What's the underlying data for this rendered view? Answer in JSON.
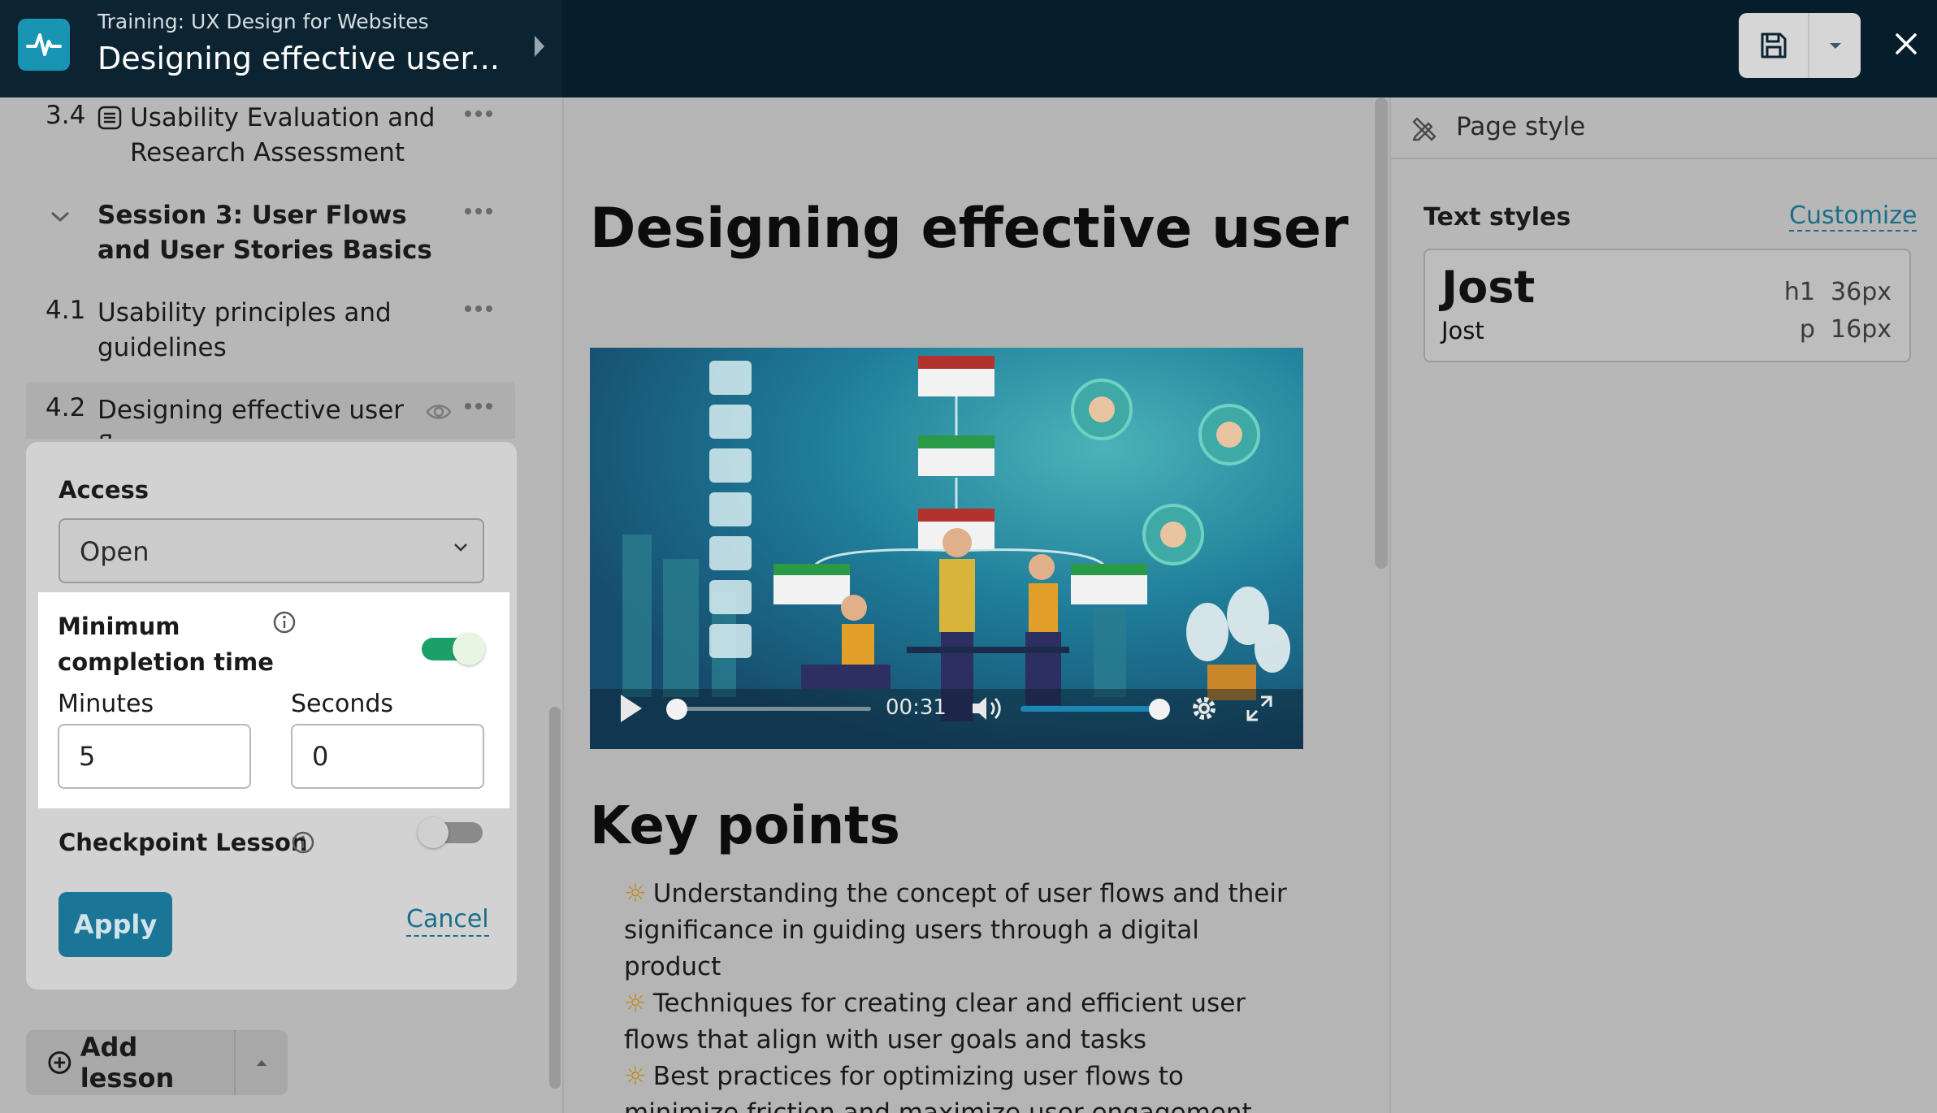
{
  "header": {
    "course_label": "Training: UX Design for Websites",
    "lesson_title": "Designing effective user..."
  },
  "sidebar": {
    "lessons": [
      {
        "num": "3.4",
        "title": "Usability Evaluation and Research Assessment"
      },
      {
        "num": "",
        "title": "Session 3: User Flows and User Stories Basics"
      },
      {
        "num": "4.1",
        "title": "Usability principles and guidelines"
      },
      {
        "num": "4.2",
        "title": "Designing effective user flows"
      }
    ],
    "add_lesson_label": "Add lesson"
  },
  "popover": {
    "access_label": "Access",
    "access_value": "Open",
    "min_completion_label": "Minimum completion time",
    "min_completion_enabled": true,
    "minutes_label": "Minutes",
    "minutes_value": "5",
    "seconds_label": "Seconds",
    "seconds_value": "0",
    "checkpoint_label": "Checkpoint Lesson",
    "checkpoint_enabled": false,
    "apply_label": "Apply",
    "cancel_label": "Cancel"
  },
  "canvas": {
    "heading": "Designing effective user",
    "video": {
      "time": "00:31",
      "progress_fraction": 0.0,
      "volume_fraction": 1.0
    },
    "key_points_heading": "Key points",
    "key_points": [
      "Understanding the concept of user flows and their significance in guiding users through a digital product",
      "Techniques for creating clear and efficient user flows that align with user goals and tasks",
      "Best practices for optimizing user flows to minimize friction and maximize user engagement"
    ]
  },
  "right_panel": {
    "title": "Page style",
    "text_styles_label": "Text styles",
    "customize_label": "Customize",
    "h1_font": "Jost",
    "h1_meta": "h1  36px",
    "p_font": "Jost",
    "p_meta": "p  16px"
  },
  "colors": {
    "topbar": "#061e2b",
    "accent": "#1a7596",
    "toggle_on": "#1ca06a",
    "logo": "#1a94b3"
  }
}
